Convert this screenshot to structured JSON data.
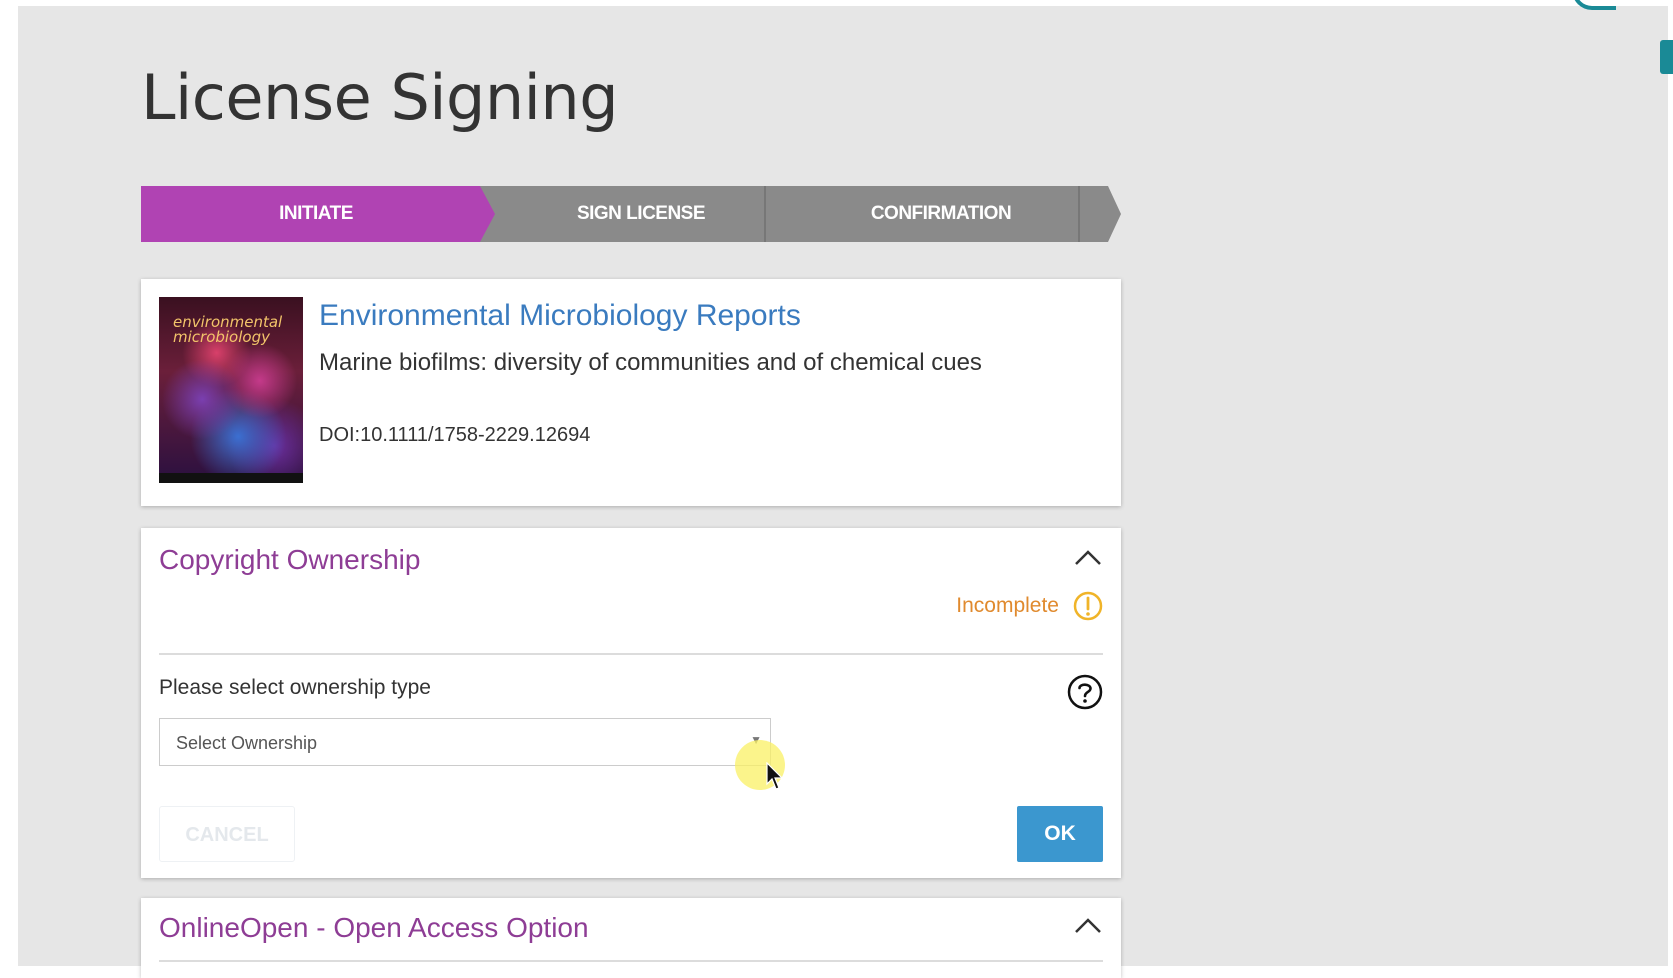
{
  "page": {
    "title": "License Signing"
  },
  "stepper": {
    "steps": [
      {
        "label": "INITIATE",
        "active": true
      },
      {
        "label": "SIGN LICENSE",
        "active": false
      },
      {
        "label": "CONFIRMATION",
        "active": false
      }
    ],
    "active_color": "#b043b3",
    "inactive_color": "#8a8a8a"
  },
  "article": {
    "cover_text": "environmental microbiology",
    "journal": "Environmental Microbiology Reports",
    "title": "Marine biofilms: diversity of communities and of chemical cues",
    "doi": "DOI:10.1111/1758-2229.12694"
  },
  "copyright": {
    "section_title": "Copyright Ownership",
    "status": "Incomplete",
    "status_color": "#e08a2e",
    "field_label": "Please select ownership type",
    "select_placeholder": "Select Ownership",
    "cancel_label": "CANCEL",
    "ok_label": "OK",
    "accent_color": "#3b97cf"
  },
  "open_access": {
    "section_title": "OnlineOpen - Open Access Option"
  },
  "icons": {
    "collapse": "chevron-up-icon",
    "warning": "exclamation-circle-icon",
    "help": "question-circle-icon",
    "dropdown": "caret-down-icon"
  }
}
